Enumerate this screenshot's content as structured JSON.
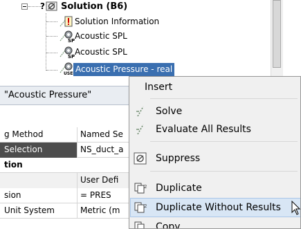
{
  "tree": {
    "root": {
      "question_mark": "?",
      "label": "Solution (B6)"
    },
    "items": [
      {
        "icon": "info-icon",
        "label": "Solution Information"
      },
      {
        "icon": "sp-result-icon",
        "icon_tag": "SP",
        "label": "Acoustic SPL"
      },
      {
        "icon": "sp-result-icon",
        "icon_tag": "SP",
        "label": "Acoustic SPL"
      },
      {
        "icon": "user-result-icon",
        "icon_tag": "USER",
        "label": "Acoustic Pressure - real",
        "selected": true
      }
    ]
  },
  "details": {
    "title": "\"Acoustic Pressure\"",
    "rows": [
      {
        "label": "g Method",
        "value": "Named Se",
        "style": "normal"
      },
      {
        "label": "Selection",
        "value": "NS_duct_a",
        "style": "dark-label"
      },
      {
        "label": "tion",
        "value": "",
        "style": "group"
      },
      {
        "label": "",
        "value": "User Defi",
        "style": "shade"
      },
      {
        "label": "sion",
        "value": "= PRES",
        "style": "normal"
      },
      {
        "label": "Unit System",
        "value": "Metric (m",
        "style": "normal"
      }
    ]
  },
  "context_menu": {
    "items": [
      {
        "label": "Insert",
        "icon": "",
        "name": "menu-insert"
      },
      {
        "label": "Solve",
        "icon": "solve-icon",
        "name": "menu-solve"
      },
      {
        "label": "Evaluate All Results",
        "icon": "evaluate-icon",
        "name": "menu-evaluate-all-results"
      },
      {
        "label": "Suppress",
        "icon": "suppress-icon",
        "name": "menu-suppress"
      },
      {
        "label": "Duplicate",
        "icon": "duplicate-icon",
        "name": "menu-duplicate"
      },
      {
        "label": "Duplicate Without Results",
        "icon": "duplicate-icon",
        "name": "menu-duplicate-without-results",
        "hover": true
      },
      {
        "label": "Copy",
        "icon": "copy-icon",
        "name": "menu-copy"
      }
    ]
  },
  "colors": {
    "selection": "#3a6fb0",
    "menu_hover": "#d8e6f5",
    "dark_cell": "#4d4d4d"
  }
}
